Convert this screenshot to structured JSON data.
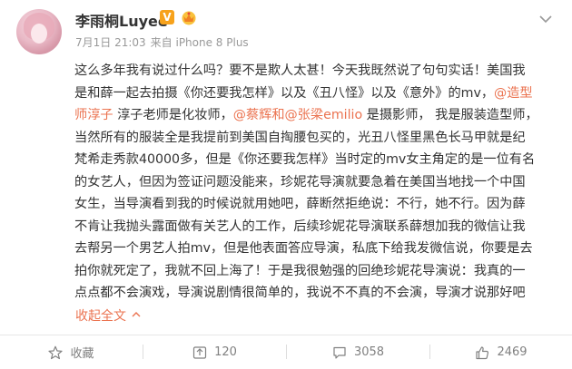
{
  "post": {
    "username": "李雨桐Luyee",
    "vip_badge": "V",
    "timestamp": "7月1日 21:03",
    "source": "来自 iPhone 8 Plus",
    "lines": [
      [
        {
          "t": "这么多年我有说过什么吗？要不是欺人太甚！今天我既然说了句句实话！美国我"
        }
      ],
      [
        {
          "t": "是和薛一起去拍摄《你还要我怎样》以及《丑八怪》以及《意外》的mv，"
        },
        {
          "t": "@造型",
          "link": true
        }
      ],
      [
        {
          "t": "师淳子",
          "link": true
        },
        {
          "t": " 淳子老师是化妆师，"
        },
        {
          "t": "@蔡辉和",
          "link": true
        },
        {
          "t": "@张梁emilio",
          "link": true
        },
        {
          "t": " 是摄影师， 我是服装造型师，"
        }
      ],
      [
        {
          "t": "当然所有的服装全是我提前到美国自掏腰包买的，光丑八怪里黑色长马甲就是纪"
        }
      ],
      [
        {
          "t": "梵希走秀款40000多，但是《你还要我怎样》当时定的mv女主角定的是一位有名"
        }
      ],
      [
        {
          "t": "的女艺人，但因为签证问题没能来，珍妮花导演就要急着在美国当地找一个中国"
        }
      ],
      [
        {
          "t": "女生，当导演看到我的时候说就用她吧，薛断然拒绝说：不行，她不行。因为薛"
        }
      ],
      [
        {
          "t": "不肯让我抛头露面做有关艺人的工作，后续珍妮花导演联系薛想加我的微信让我"
        }
      ],
      [
        {
          "t": "去帮另一个男艺人拍mv，但是他表面答应导演，私底下给我发微信说，你要是去"
        }
      ],
      [
        {
          "t": "拍你就死定了，我就不回上海了！于是我很勉强的回绝珍妮花导演说：我真的一"
        }
      ],
      [
        {
          "t": "点点都不会演戏，导演说剧情很简单的，我说不不真的不会演，导演才说那好吧"
        }
      ]
    ],
    "collapse_label": "收起全文"
  },
  "actions": {
    "favorite_label": "收藏",
    "repost_count": "120",
    "comment_count": "3058",
    "like_count": "2469"
  },
  "colors": {
    "link": "#eb7350",
    "text": "#333333",
    "meta": "#999999",
    "action": "#808080",
    "vip": "#f7a21b"
  },
  "icons": [
    "avatar",
    "vip-badge",
    "crown-icon",
    "chevron-down-icon",
    "star-icon",
    "repost-icon",
    "comment-icon",
    "like-icon"
  ]
}
